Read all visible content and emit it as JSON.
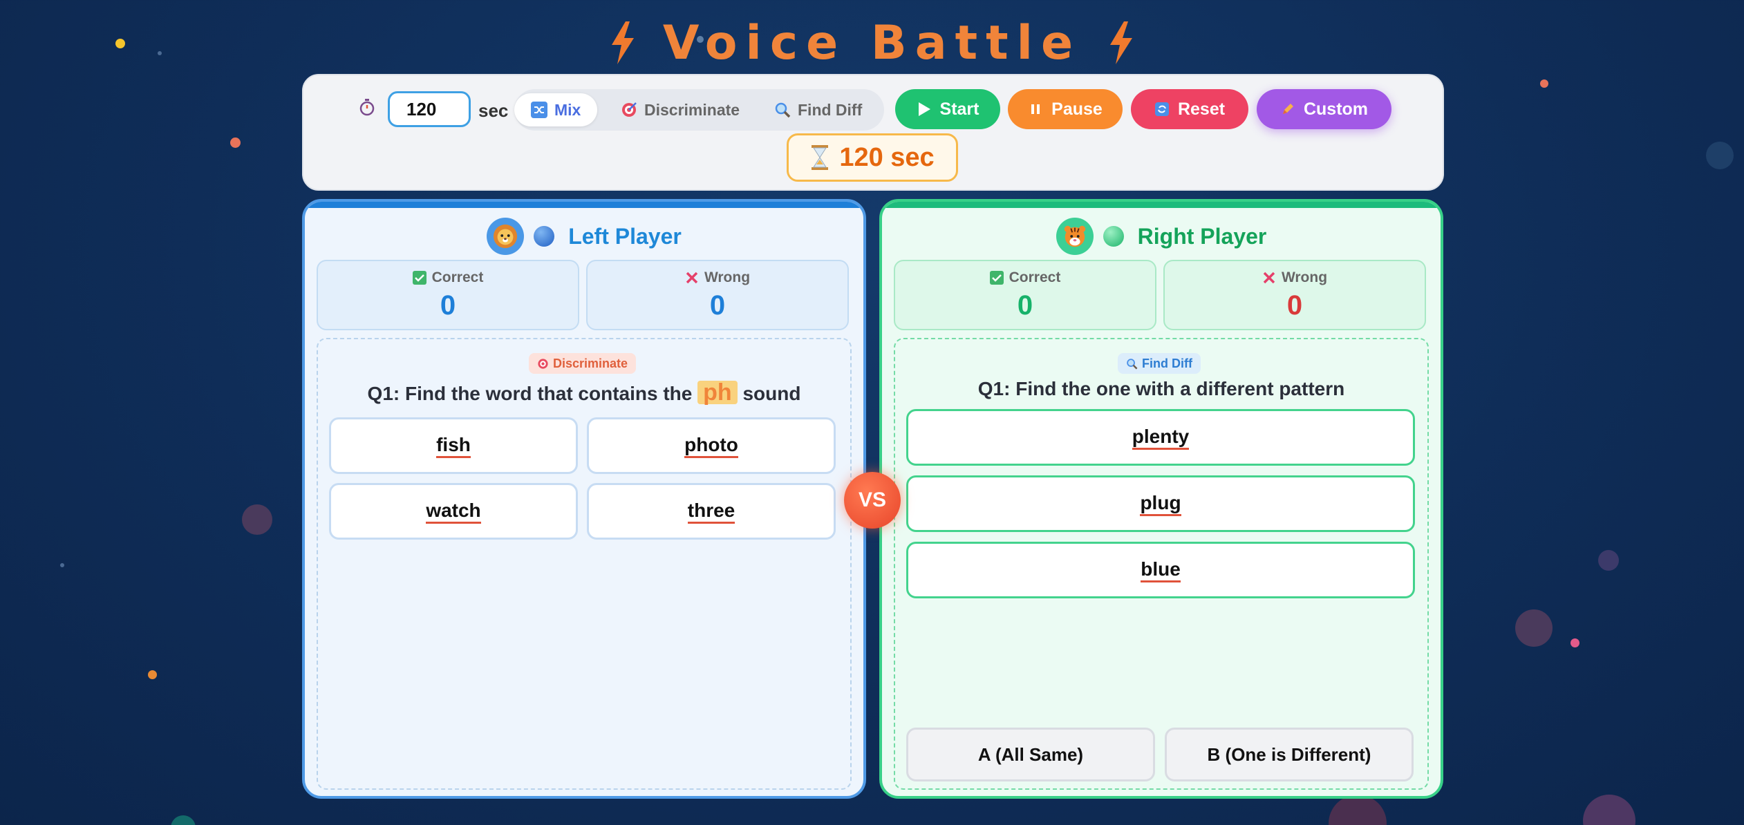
{
  "app": {
    "title": "Voice Battle"
  },
  "toolbar": {
    "time_value": "120",
    "sec_label": "sec",
    "modes": [
      {
        "label": "Mix",
        "active": true
      },
      {
        "label": "Discriminate",
        "active": false
      },
      {
        "label": "Find Diff",
        "active": false
      }
    ],
    "start_label": "Start",
    "pause_label": "Pause",
    "reset_label": "Reset",
    "custom_label": "Custom",
    "timer_text": "120 sec"
  },
  "left_player": {
    "name": "Left Player",
    "correct_label": "Correct",
    "wrong_label": "Wrong",
    "correct": "0",
    "wrong": "0",
    "question": {
      "tag": "Discriminate",
      "prefix": "Q1: Find the word that contains the",
      "sound": "ph",
      "suffix": "sound",
      "options": [
        "fish",
        "photo",
        "watch",
        "three"
      ]
    }
  },
  "right_player": {
    "name": "Right Player",
    "correct_label": "Correct",
    "wrong_label": "Wrong",
    "correct": "0",
    "wrong": "0",
    "question": {
      "tag": "Find Diff",
      "text": "Q1: Find the one with a different pattern",
      "options": [
        "plenty",
        "plug",
        "blue"
      ],
      "answer_a": "A (All Same)",
      "answer_b": "B (One is Different)"
    }
  },
  "vs_label": "VS",
  "colors": {
    "left_accent": "#1e88d8",
    "right_accent": "#14a35a",
    "start": "#1fc271",
    "pause": "#f98b2e",
    "reset": "#ee4263",
    "custom": "#a259e6",
    "wrong_value_right": "#d93a3a"
  }
}
